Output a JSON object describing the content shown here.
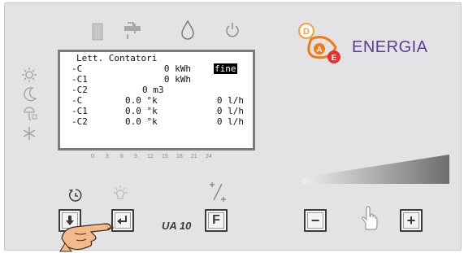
{
  "brand": {
    "name": "ENERGIA",
    "logo_letters": [
      "D",
      "A",
      "E"
    ]
  },
  "display": {
    "title": "Lett. Contatori",
    "rows": [
      {
        "label": "-C",
        "value": "0 kWh",
        "flag": "fine"
      },
      {
        "label": "-C1",
        "value": "0 kWh",
        "flag": ""
      },
      {
        "label": "-C2",
        "value": "0 m3",
        "flag": ""
      },
      {
        "label": "-C",
        "temp": "0.0 °k",
        "flow": "0 l/h"
      },
      {
        "label": "-C1",
        "temp": "0.0 °k",
        "flow": "0 l/h"
      },
      {
        "label": "-C2",
        "temp": "0.0 °k",
        "flow": "0 l/h"
      }
    ]
  },
  "hour_scale": [
    "0",
    "3",
    "6",
    "9",
    "12",
    "15",
    "18",
    "21",
    "24"
  ],
  "model": "UA 10",
  "buttons": {
    "down": "down-arrow",
    "enter": "enter-arrow",
    "function_label": "F",
    "minus_label": "−",
    "plus_label": "+"
  },
  "top_icons": [
    "heater-icon",
    "tap-icon",
    "drop-icon",
    "power-icon"
  ],
  "side_icons": [
    "sun-icon",
    "moon-icon",
    "sun-cloud-icon",
    "snowflake-icon"
  ],
  "colors": {
    "panel": "#e3e3e5",
    "brand": "#5a3e94",
    "logo_orange": "#f07a1a",
    "logo_red": "#e8312a"
  }
}
